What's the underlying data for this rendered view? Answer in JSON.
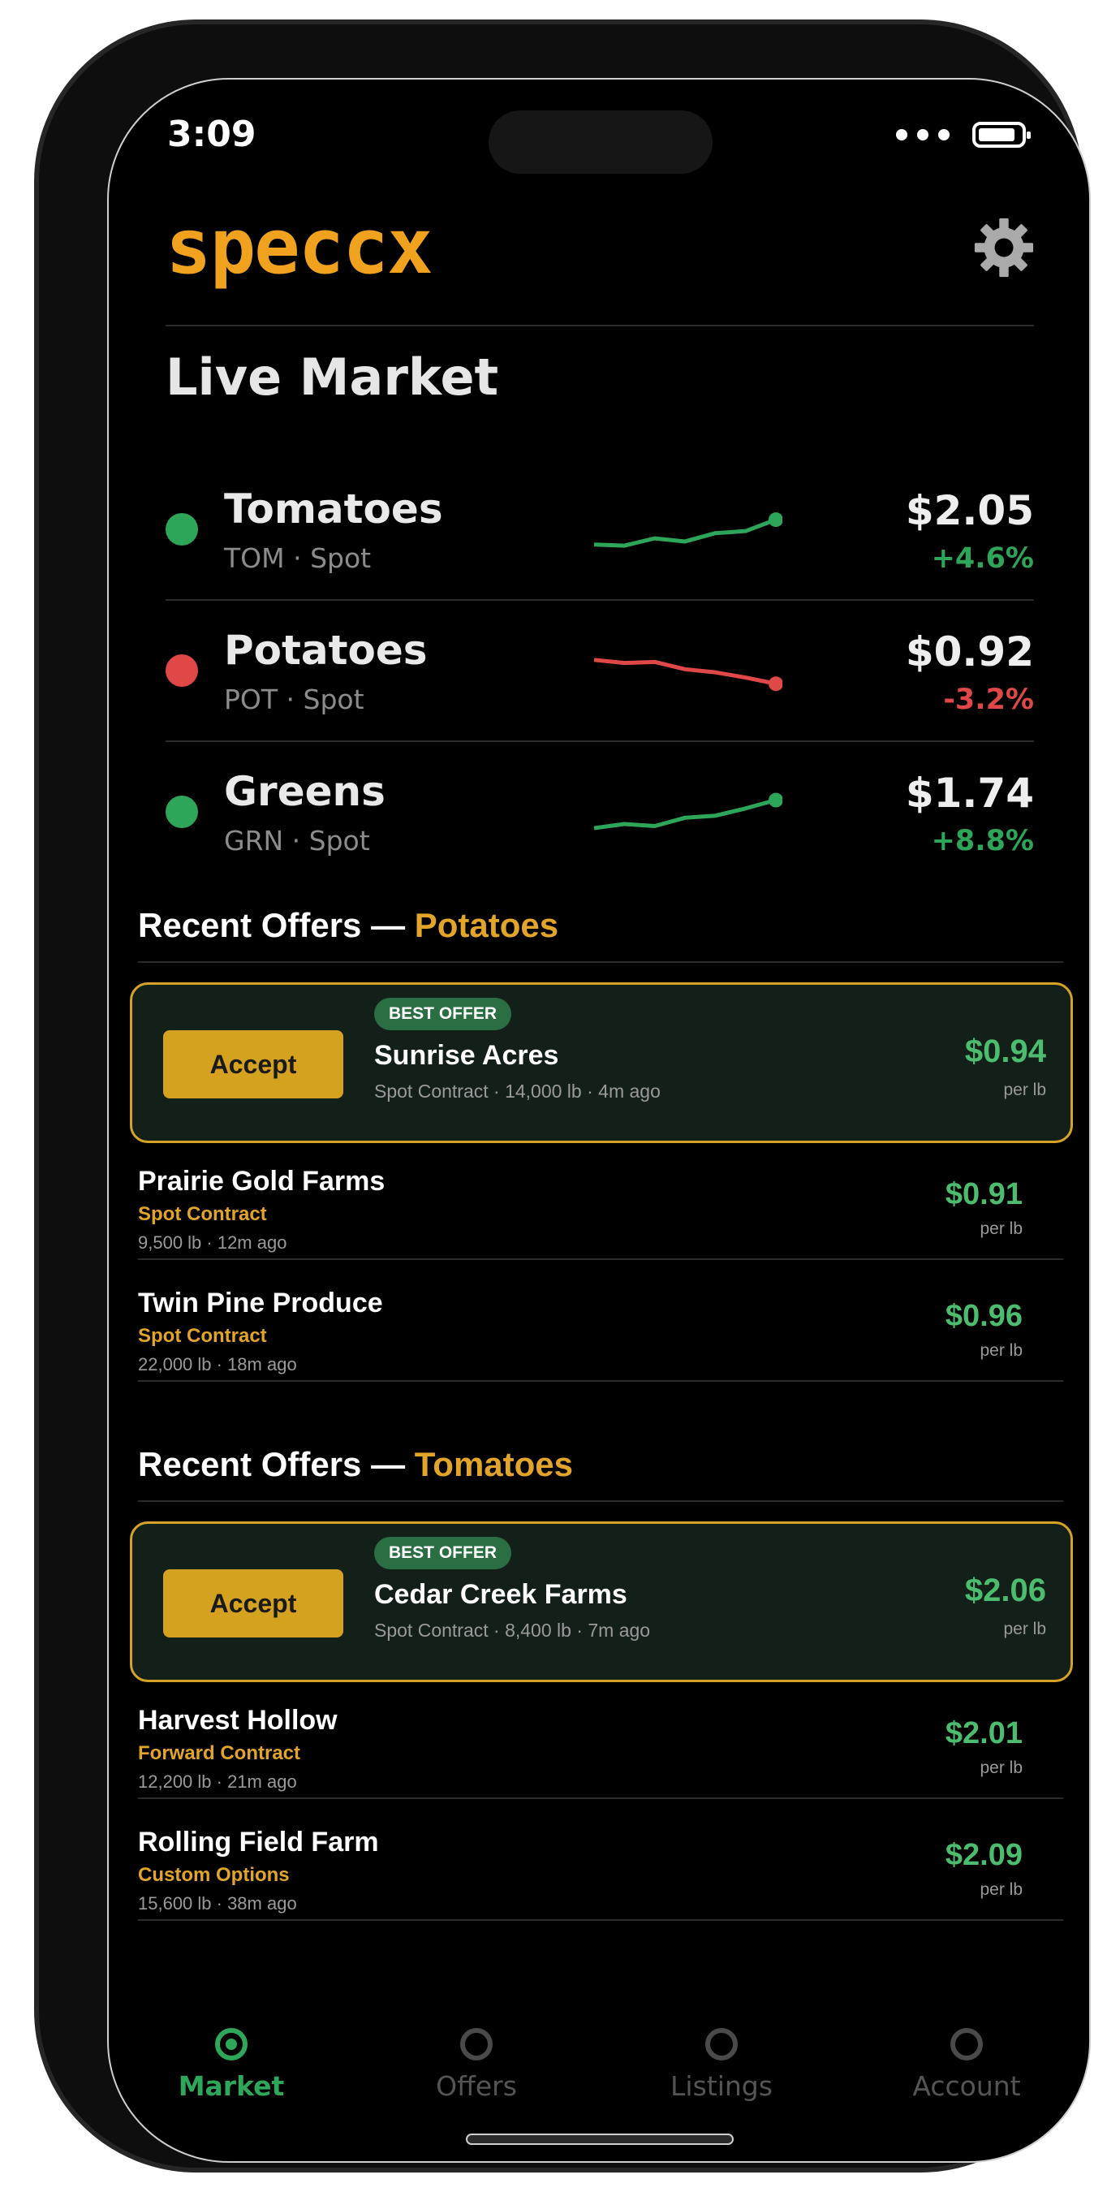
{
  "status_bar": {
    "time": "3:09"
  },
  "header": {
    "logo_text": "speccx",
    "settings_icon": "gear-icon"
  },
  "live_market": {
    "title": "Live Market",
    "items": [
      {
        "name": "Tomatoes",
        "sub": "TOM · Spot",
        "price": "$2.05",
        "change": "+4.6%",
        "trend": "up",
        "color": "#2ea65a",
        "spark": [
          0.3,
          0.28,
          0.42,
          0.36,
          0.52,
          0.56,
          0.78
        ]
      },
      {
        "name": "Potatoes",
        "sub": "POT · Spot",
        "price": "$0.92",
        "change": "-3.2%",
        "trend": "down",
        "color": "#e04848",
        "spark": [
          0.8,
          0.74,
          0.76,
          0.62,
          0.56,
          0.46,
          0.34
        ]
      },
      {
        "name": "Greens",
        "sub": "GRN · Spot",
        "price": "$1.74",
        "change": "+8.8%",
        "trend": "up",
        "color": "#2ea65a",
        "spark": [
          0.28,
          0.36,
          0.32,
          0.48,
          0.52,
          0.66,
          0.82
        ]
      }
    ]
  },
  "potatoes_offers": {
    "title_prefix": "Recent Offers — ",
    "title_highlight": "Potatoes",
    "best": {
      "badge": "BEST OFFER",
      "accept_label": "Accept",
      "farm": "Sunrise Acres",
      "meta": "Spot Contract  ·  14,000 lb · 4m ago",
      "price": "$0.94",
      "unit": "per lb"
    },
    "others": [
      {
        "farm": "Prairie Gold Farms",
        "contract": "Spot Contract",
        "meta": "9,500 lb · 12m ago",
        "price": "$0.91",
        "unit": "per lb"
      },
      {
        "farm": "Twin Pine Produce",
        "contract": "Spot Contract",
        "meta": "22,000 lb · 18m ago",
        "price": "$0.96",
        "unit": "per lb"
      }
    ]
  },
  "tomatoes_offers": {
    "title_prefix": "Recent Offers — ",
    "title_highlight": "Tomatoes",
    "best": {
      "badge": "BEST OFFER",
      "accept_label": "Accept",
      "farm": "Cedar Creek Farms",
      "meta": "Spot Contract  ·  8,400 lb · 7m ago",
      "price": "$2.06",
      "unit": "per lb"
    },
    "others": [
      {
        "farm": "Harvest Hollow",
        "contract": "Forward Contract",
        "meta": "12,200 lb · 21m ago",
        "price": "$2.01",
        "unit": "per lb"
      },
      {
        "farm": "Rolling Field Farm",
        "contract": "Custom Options",
        "meta": "15,600 lb · 38m ago",
        "price": "$2.09",
        "unit": "per lb"
      }
    ]
  },
  "bottom_nav": {
    "items": [
      {
        "label": "Market",
        "active": true
      },
      {
        "label": "Offers",
        "active": false
      },
      {
        "label": "Listings",
        "active": false
      },
      {
        "label": "Account",
        "active": false
      }
    ]
  },
  "colors": {
    "accent": "#e2a52a",
    "positive": "#4cbd6e",
    "negative": "#e04848",
    "nav_active": "#2fa75a"
  }
}
